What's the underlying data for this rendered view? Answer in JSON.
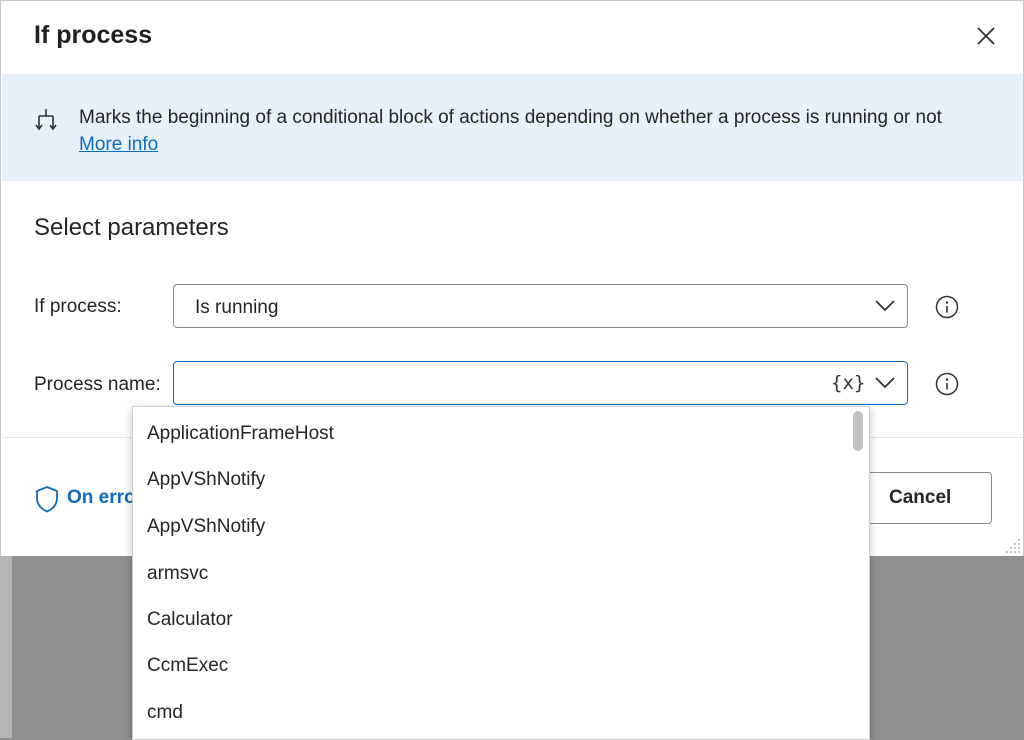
{
  "dialog": {
    "title": "If process",
    "description": "Marks the beginning of a conditional block of actions depending on whether a process is running or not",
    "more_info_link": "More info",
    "section_title": "Select parameters"
  },
  "params": {
    "if_process_label": "If process:",
    "if_process_value": "Is running",
    "process_name_label": "Process name:",
    "process_name_value": "",
    "variable_button": "{x}"
  },
  "footer": {
    "on_error_label": "On error",
    "cancel_label": "Cancel"
  },
  "dropdown": {
    "items": [
      "ApplicationFrameHost",
      "AppVShNotify",
      "AppVShNotify",
      "armsvc",
      "Calculator",
      "CcmExec",
      "cmd"
    ]
  },
  "colors": {
    "accent": "#0f6cbd",
    "banner_bg": "#e7f0fb",
    "backdrop": "#8f8f8f"
  },
  "icons": {
    "close": "close-icon",
    "banner": "split-arrow-icon",
    "info": "info-icon",
    "chevron": "chevron-down-icon",
    "shield": "shield-icon"
  }
}
